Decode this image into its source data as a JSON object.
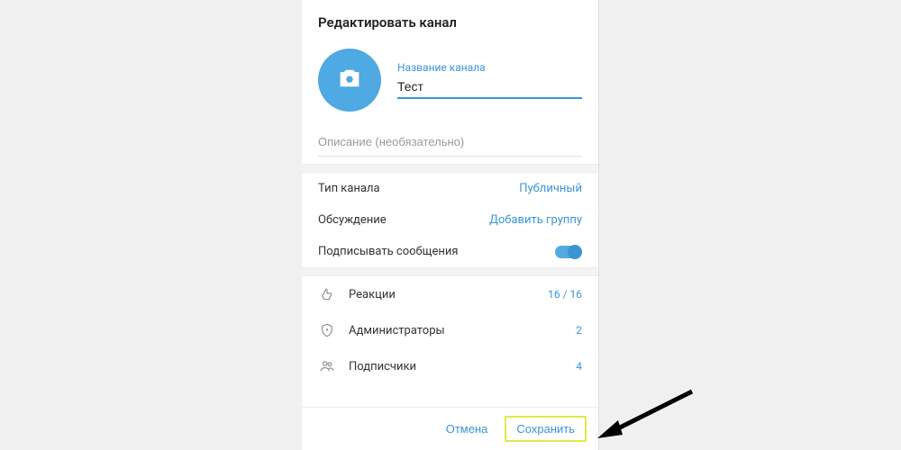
{
  "header": {
    "title": "Редактировать канал"
  },
  "profile": {
    "name_label": "Название канала",
    "name_value": "Тест"
  },
  "description": {
    "placeholder": "Описание (необязательно)"
  },
  "settings": {
    "channel_type": {
      "label": "Тип канала",
      "value": "Публичный"
    },
    "discussion": {
      "label": "Обсуждение",
      "value": "Добавить группу"
    },
    "sign_messages": {
      "label": "Подписывать сообщения"
    }
  },
  "lists": {
    "reactions": {
      "label": "Реакции",
      "value": "16 / 16"
    },
    "admins": {
      "label": "Администраторы",
      "value": "2"
    },
    "subscribers": {
      "label": "Подписчики",
      "value": "4"
    }
  },
  "footer": {
    "cancel": "Отмена",
    "save": "Сохранить"
  },
  "colors": {
    "accent": "#3a95d5",
    "highlight": "#e2e84a"
  }
}
